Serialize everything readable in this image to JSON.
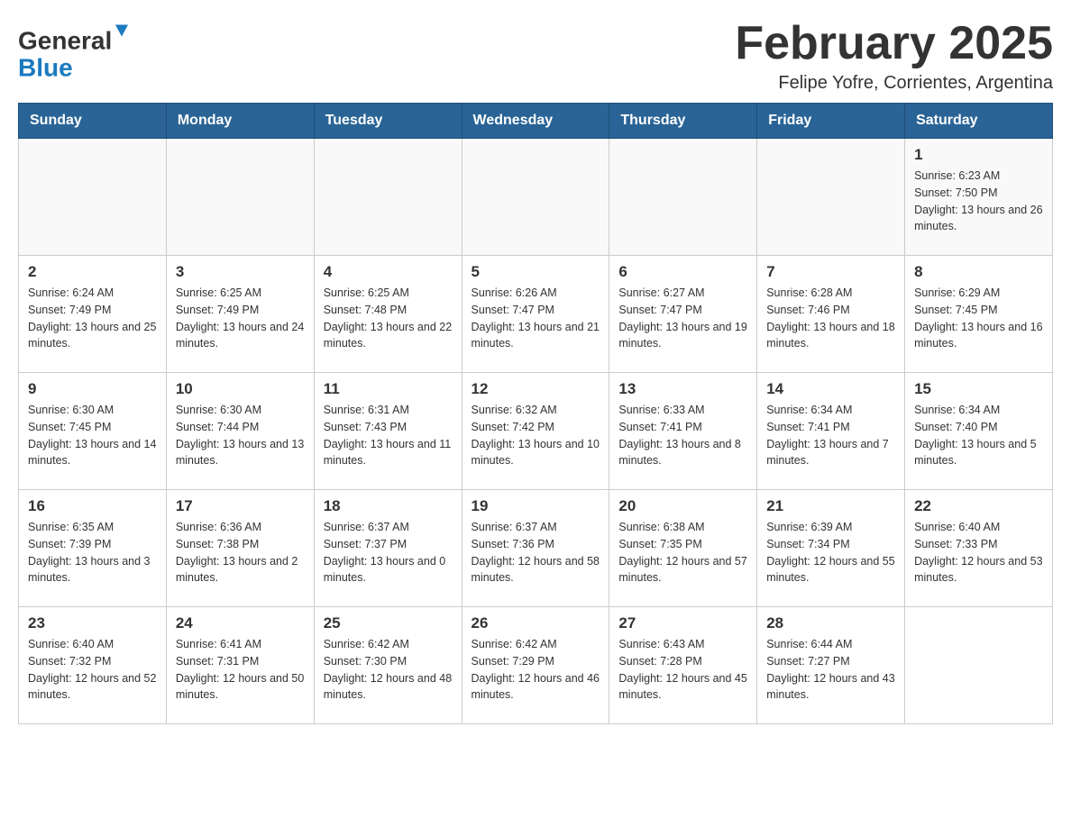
{
  "header": {
    "title": "February 2025",
    "location": "Felipe Yofre, Corrientes, Argentina",
    "logo_general": "General",
    "logo_blue": "Blue"
  },
  "days_of_week": [
    "Sunday",
    "Monday",
    "Tuesday",
    "Wednesday",
    "Thursday",
    "Friday",
    "Saturday"
  ],
  "weeks": [
    [
      {
        "day": "",
        "sunrise": "",
        "sunset": "",
        "daylight": ""
      },
      {
        "day": "",
        "sunrise": "",
        "sunset": "",
        "daylight": ""
      },
      {
        "day": "",
        "sunrise": "",
        "sunset": "",
        "daylight": ""
      },
      {
        "day": "",
        "sunrise": "",
        "sunset": "",
        "daylight": ""
      },
      {
        "day": "",
        "sunrise": "",
        "sunset": "",
        "daylight": ""
      },
      {
        "day": "",
        "sunrise": "",
        "sunset": "",
        "daylight": ""
      },
      {
        "day": "1",
        "sunrise": "Sunrise: 6:23 AM",
        "sunset": "Sunset: 7:50 PM",
        "daylight": "Daylight: 13 hours and 26 minutes."
      }
    ],
    [
      {
        "day": "2",
        "sunrise": "Sunrise: 6:24 AM",
        "sunset": "Sunset: 7:49 PM",
        "daylight": "Daylight: 13 hours and 25 minutes."
      },
      {
        "day": "3",
        "sunrise": "Sunrise: 6:25 AM",
        "sunset": "Sunset: 7:49 PM",
        "daylight": "Daylight: 13 hours and 24 minutes."
      },
      {
        "day": "4",
        "sunrise": "Sunrise: 6:25 AM",
        "sunset": "Sunset: 7:48 PM",
        "daylight": "Daylight: 13 hours and 22 minutes."
      },
      {
        "day": "5",
        "sunrise": "Sunrise: 6:26 AM",
        "sunset": "Sunset: 7:47 PM",
        "daylight": "Daylight: 13 hours and 21 minutes."
      },
      {
        "day": "6",
        "sunrise": "Sunrise: 6:27 AM",
        "sunset": "Sunset: 7:47 PM",
        "daylight": "Daylight: 13 hours and 19 minutes."
      },
      {
        "day": "7",
        "sunrise": "Sunrise: 6:28 AM",
        "sunset": "Sunset: 7:46 PM",
        "daylight": "Daylight: 13 hours and 18 minutes."
      },
      {
        "day": "8",
        "sunrise": "Sunrise: 6:29 AM",
        "sunset": "Sunset: 7:45 PM",
        "daylight": "Daylight: 13 hours and 16 minutes."
      }
    ],
    [
      {
        "day": "9",
        "sunrise": "Sunrise: 6:30 AM",
        "sunset": "Sunset: 7:45 PM",
        "daylight": "Daylight: 13 hours and 14 minutes."
      },
      {
        "day": "10",
        "sunrise": "Sunrise: 6:30 AM",
        "sunset": "Sunset: 7:44 PM",
        "daylight": "Daylight: 13 hours and 13 minutes."
      },
      {
        "day": "11",
        "sunrise": "Sunrise: 6:31 AM",
        "sunset": "Sunset: 7:43 PM",
        "daylight": "Daylight: 13 hours and 11 minutes."
      },
      {
        "day": "12",
        "sunrise": "Sunrise: 6:32 AM",
        "sunset": "Sunset: 7:42 PM",
        "daylight": "Daylight: 13 hours and 10 minutes."
      },
      {
        "day": "13",
        "sunrise": "Sunrise: 6:33 AM",
        "sunset": "Sunset: 7:41 PM",
        "daylight": "Daylight: 13 hours and 8 minutes."
      },
      {
        "day": "14",
        "sunrise": "Sunrise: 6:34 AM",
        "sunset": "Sunset: 7:41 PM",
        "daylight": "Daylight: 13 hours and 7 minutes."
      },
      {
        "day": "15",
        "sunrise": "Sunrise: 6:34 AM",
        "sunset": "Sunset: 7:40 PM",
        "daylight": "Daylight: 13 hours and 5 minutes."
      }
    ],
    [
      {
        "day": "16",
        "sunrise": "Sunrise: 6:35 AM",
        "sunset": "Sunset: 7:39 PM",
        "daylight": "Daylight: 13 hours and 3 minutes."
      },
      {
        "day": "17",
        "sunrise": "Sunrise: 6:36 AM",
        "sunset": "Sunset: 7:38 PM",
        "daylight": "Daylight: 13 hours and 2 minutes."
      },
      {
        "day": "18",
        "sunrise": "Sunrise: 6:37 AM",
        "sunset": "Sunset: 7:37 PM",
        "daylight": "Daylight: 13 hours and 0 minutes."
      },
      {
        "day": "19",
        "sunrise": "Sunrise: 6:37 AM",
        "sunset": "Sunset: 7:36 PM",
        "daylight": "Daylight: 12 hours and 58 minutes."
      },
      {
        "day": "20",
        "sunrise": "Sunrise: 6:38 AM",
        "sunset": "Sunset: 7:35 PM",
        "daylight": "Daylight: 12 hours and 57 minutes."
      },
      {
        "day": "21",
        "sunrise": "Sunrise: 6:39 AM",
        "sunset": "Sunset: 7:34 PM",
        "daylight": "Daylight: 12 hours and 55 minutes."
      },
      {
        "day": "22",
        "sunrise": "Sunrise: 6:40 AM",
        "sunset": "Sunset: 7:33 PM",
        "daylight": "Daylight: 12 hours and 53 minutes."
      }
    ],
    [
      {
        "day": "23",
        "sunrise": "Sunrise: 6:40 AM",
        "sunset": "Sunset: 7:32 PM",
        "daylight": "Daylight: 12 hours and 52 minutes."
      },
      {
        "day": "24",
        "sunrise": "Sunrise: 6:41 AM",
        "sunset": "Sunset: 7:31 PM",
        "daylight": "Daylight: 12 hours and 50 minutes."
      },
      {
        "day": "25",
        "sunrise": "Sunrise: 6:42 AM",
        "sunset": "Sunset: 7:30 PM",
        "daylight": "Daylight: 12 hours and 48 minutes."
      },
      {
        "day": "26",
        "sunrise": "Sunrise: 6:42 AM",
        "sunset": "Sunset: 7:29 PM",
        "daylight": "Daylight: 12 hours and 46 minutes."
      },
      {
        "day": "27",
        "sunrise": "Sunrise: 6:43 AM",
        "sunset": "Sunset: 7:28 PM",
        "daylight": "Daylight: 12 hours and 45 minutes."
      },
      {
        "day": "28",
        "sunrise": "Sunrise: 6:44 AM",
        "sunset": "Sunset: 7:27 PM",
        "daylight": "Daylight: 12 hours and 43 minutes."
      },
      {
        "day": "",
        "sunrise": "",
        "sunset": "",
        "daylight": ""
      }
    ]
  ]
}
